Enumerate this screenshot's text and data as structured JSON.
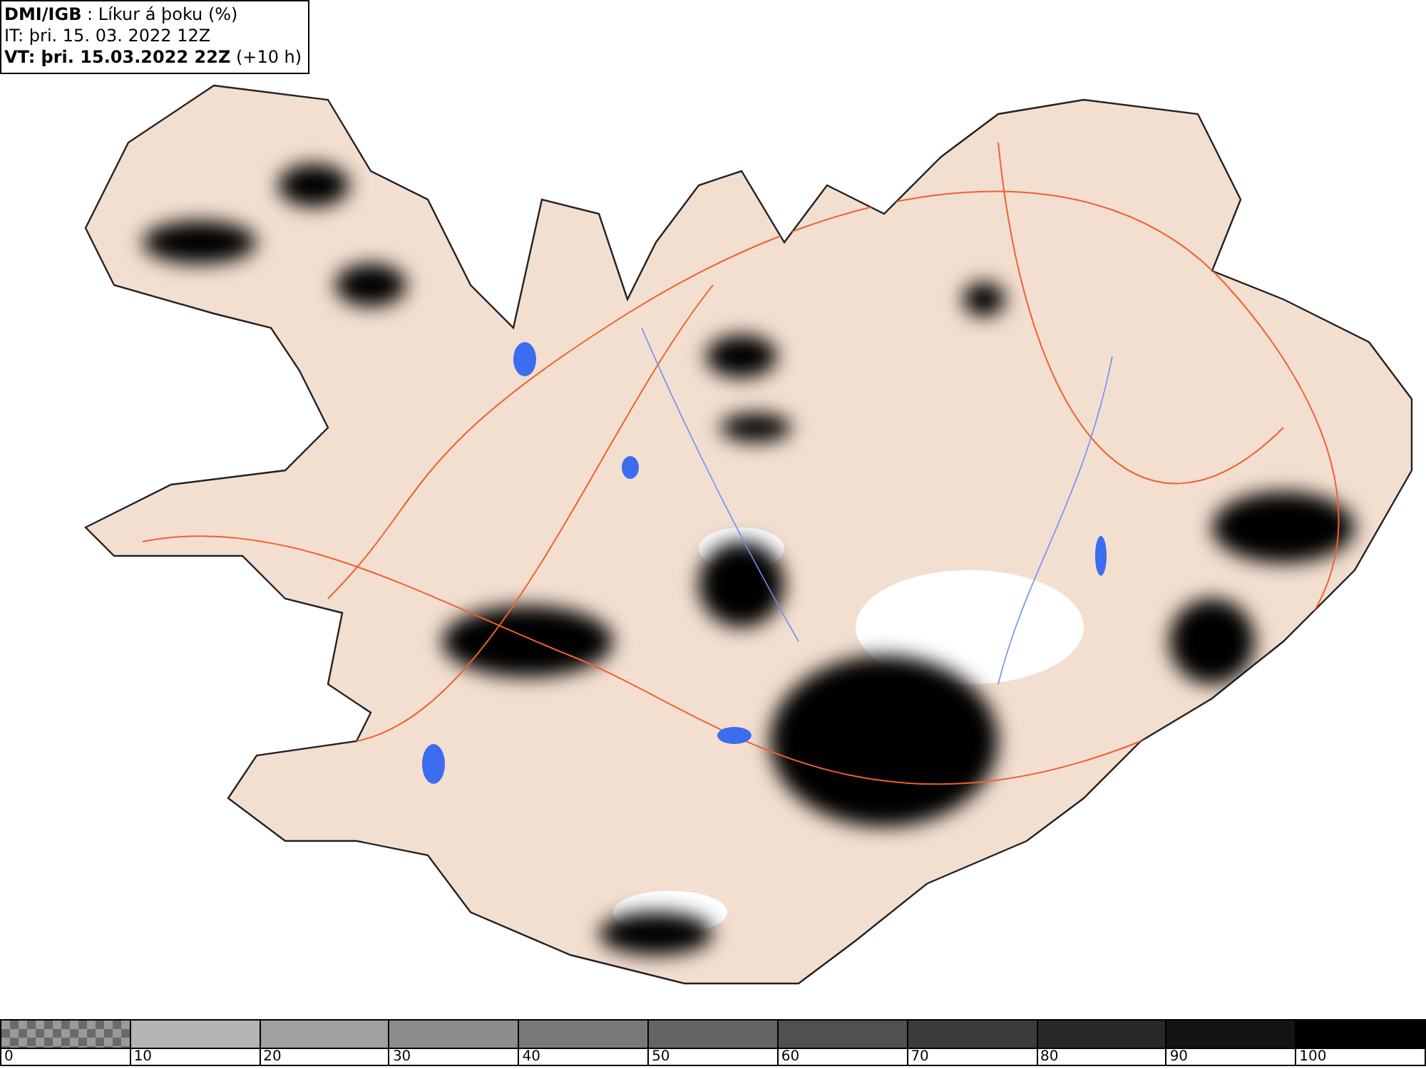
{
  "header": {
    "title": "**DMI/IGB** : Líkur á þoku (%)",
    "issue_time": "IT: þri. 15. 03. 2022 12Z",
    "valid_time": "**VT: þri. 15.03.2022 22Z** (+10 h)"
  },
  "legend": [
    {
      "kind": "checker",
      "label": "0",
      "color": "#9a9a9a"
    },
    {
      "kind": "solid",
      "label": "10",
      "color": "#b4b4b4"
    },
    {
      "kind": "solid",
      "label": "20",
      "color": "#a0a0a0"
    },
    {
      "kind": "solid",
      "label": "30",
      "color": "#8c8c8c"
    },
    {
      "kind": "solid",
      "label": "40",
      "color": "#787878"
    },
    {
      "kind": "solid",
      "label": "50",
      "color": "#646464"
    },
    {
      "kind": "solid",
      "label": "60",
      "color": "#505050"
    },
    {
      "kind": "solid",
      "label": "70",
      "color": "#3c3c3c"
    },
    {
      "kind": "solid",
      "label": "80",
      "color": "#282828"
    },
    {
      "kind": "solid",
      "label": "90",
      "color": "#141414"
    },
    {
      "kind": "solid",
      "label": "100",
      "color": "#000000"
    }
  ]
}
